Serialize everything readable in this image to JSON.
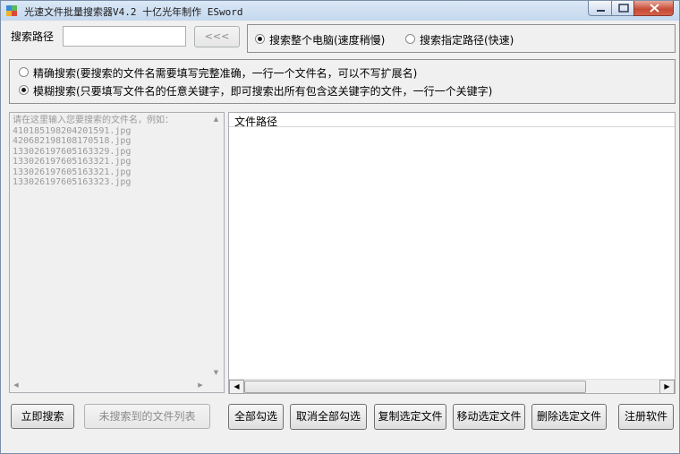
{
  "window": {
    "title": "光速文件批量搜索器V4.2 十亿光年制作 ESword",
    "icon": "app-icon"
  },
  "search_path": {
    "label": "搜索路径",
    "value": "",
    "browse_label": "<<<"
  },
  "scope": {
    "options": [
      {
        "label": "搜索整个电脑(速度稍慢)",
        "selected": true
      },
      {
        "label": "搜索指定路径(快速)",
        "selected": false
      }
    ]
  },
  "mode": {
    "options": [
      {
        "label": "精确搜索(要搜索的文件名需要填写完整准确，一行一个文件名，可以不写扩展名)",
        "selected": false
      },
      {
        "label": "模糊搜索(只要填写文件名的任意关键字，即可搜索出所有包含这关键字的文件，一行一个关键字)",
        "selected": true
      }
    ]
  },
  "input_area": {
    "text": "请在这里输入您要搜索的文件名，例如：\n410185198204201591.jpg\n420682198108170518.jpg\n133026197605163329.jpg\n133026197605163321.jpg\n133026197605163321.jpg\n133026197605163323.jpg"
  },
  "results": {
    "column_header": "文件路径"
  },
  "buttons": {
    "search_now": "立即搜索",
    "not_found_list": "未搜索到的文件列表",
    "select_all": "全部勾选",
    "deselect_all": "取消全部勾选",
    "copy_selected": "复制选定文件",
    "move_selected": "移动选定文件",
    "delete_selected": "删除选定文件",
    "register": "注册软件"
  }
}
